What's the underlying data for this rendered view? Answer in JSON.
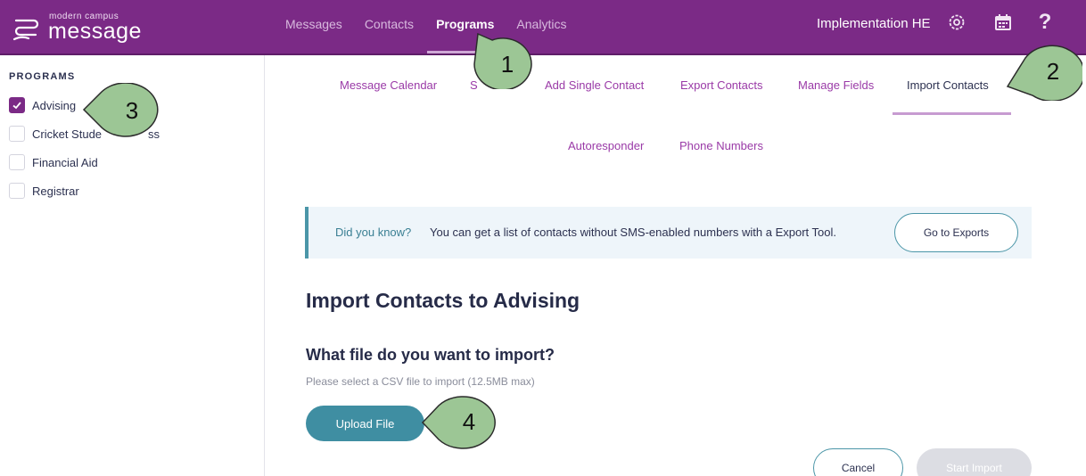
{
  "brand": {
    "small": "modern campus",
    "big": "message"
  },
  "nav": [
    "Messages",
    "Contacts",
    "Programs",
    "Analytics"
  ],
  "nav_active": "Programs",
  "org": "Implementation HE",
  "sidebar": {
    "title": "PROGRAMS",
    "items": [
      {
        "label": "Advising",
        "checked": true
      },
      {
        "label": "Cricket Stude",
        "checked": false
      },
      {
        "label": "Financial Aid",
        "checked": false
      },
      {
        "label": "Registrar",
        "checked": false
      }
    ],
    "item2_tail": "ss"
  },
  "subnav": {
    "row1": [
      "Message Calendar",
      "S",
      "Add Single Contact",
      "Export Contacts",
      "Manage Fields",
      "Import Contacts"
    ],
    "row2": [
      "Autoresponder",
      "Phone Numbers"
    ],
    "active": "Import Contacts"
  },
  "banner": {
    "question": "Did you know?",
    "text": "You can get a list of contacts without SMS-enabled numbers with a Export Tool.",
    "button": "Go to Exports"
  },
  "main": {
    "title": "Import Contacts to Advising",
    "subtitle": "What file do you want to import?",
    "hint": "Please select a CSV file to import (12.5MB max)",
    "upload_label": "Upload File",
    "cancel_label": "Cancel",
    "start_label": "Start Import"
  },
  "callouts": [
    "1",
    "2",
    "3",
    "4"
  ],
  "colors": {
    "brand": "#7b2a86",
    "accent": "#3f8ea2",
    "callout": "#9cc695"
  }
}
